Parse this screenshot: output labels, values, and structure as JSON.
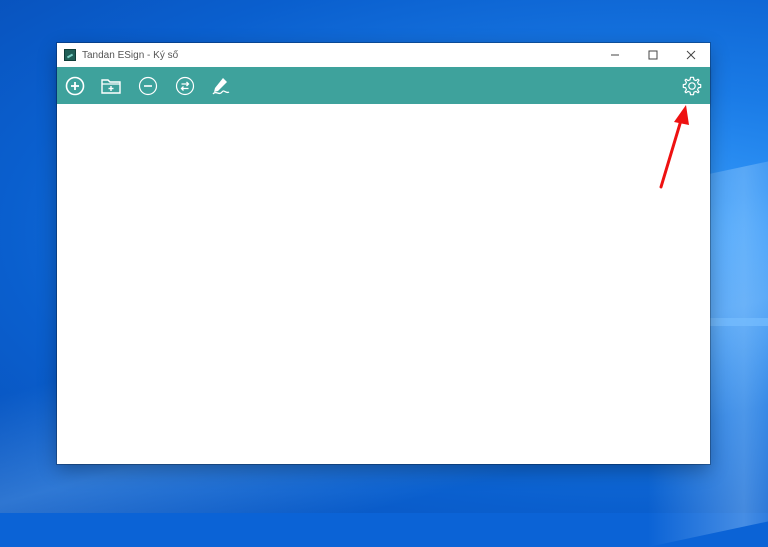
{
  "window": {
    "title": "Tandan ESign - Ký số",
    "controls": {
      "minimize": "—",
      "maximize": "☐",
      "close": "✕"
    }
  },
  "toolbar": {
    "buttons": [
      {
        "name": "add-button",
        "icon": "plus-circle-icon"
      },
      {
        "name": "add-folder-button",
        "icon": "folder-plus-icon"
      },
      {
        "name": "remove-button",
        "icon": "minus-circle-icon"
      },
      {
        "name": "swap-button",
        "icon": "swap-circle-icon"
      },
      {
        "name": "sign-button",
        "icon": "pen-sign-icon"
      }
    ],
    "settings": {
      "icon": "gear-icon"
    },
    "color": "#3ea29c"
  },
  "annotation": {
    "icon": "red-arrow-icon",
    "color": "#ee1111"
  }
}
